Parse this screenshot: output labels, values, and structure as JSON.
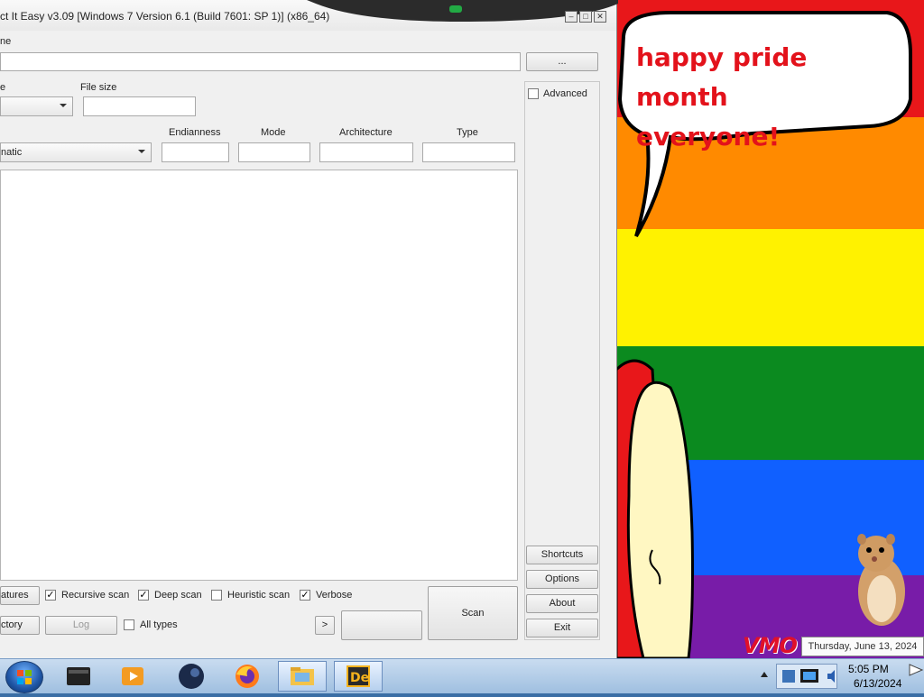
{
  "window": {
    "title": "ct It Easy v3.09 [Windows 7 Version 6.1 (Build 7601: SP 1)] (x86_64)"
  },
  "form": {
    "name_label": "ne",
    "browse_button": "...",
    "type_label": "e",
    "file_size_label": "File size",
    "advanced_label": "Advanced",
    "mode_combo_value": "natic",
    "endianness_label": "Endianness",
    "mode_label": "Mode",
    "architecture_label": "Architecture",
    "type_col_label": "Type"
  },
  "side_buttons": {
    "shortcuts": "Shortcuts",
    "options": "Options",
    "about": "About",
    "exit": "Exit"
  },
  "bottom": {
    "signatures_button": "atures",
    "recursive_scan": "Recursive scan",
    "deep_scan": "Deep scan",
    "heuristic_scan": "Heuristic scan",
    "verbose": "Verbose",
    "directory_button": "ctory",
    "log_button": "Log",
    "all_types": "All types",
    "more_button": ">",
    "scan_button": "Scan",
    "check_mark": "✓"
  },
  "wallpaper": {
    "speech_line1": "happy pride month",
    "speech_line2": "everyone!",
    "logo_text": "VMO"
  },
  "taskbar": {
    "time": "5:05 PM",
    "date": "6/13/2024",
    "tooltip": "Thursday, June 13, 2024"
  },
  "colors": {
    "pride_red": "#e8171a",
    "pride_orange": "#ff8a00",
    "pride_yellow": "#fff200",
    "pride_green": "#0b8a1f",
    "pride_blue": "#1060ff",
    "pride_purple": "#781ca8",
    "speech_text": "#e3121b"
  }
}
